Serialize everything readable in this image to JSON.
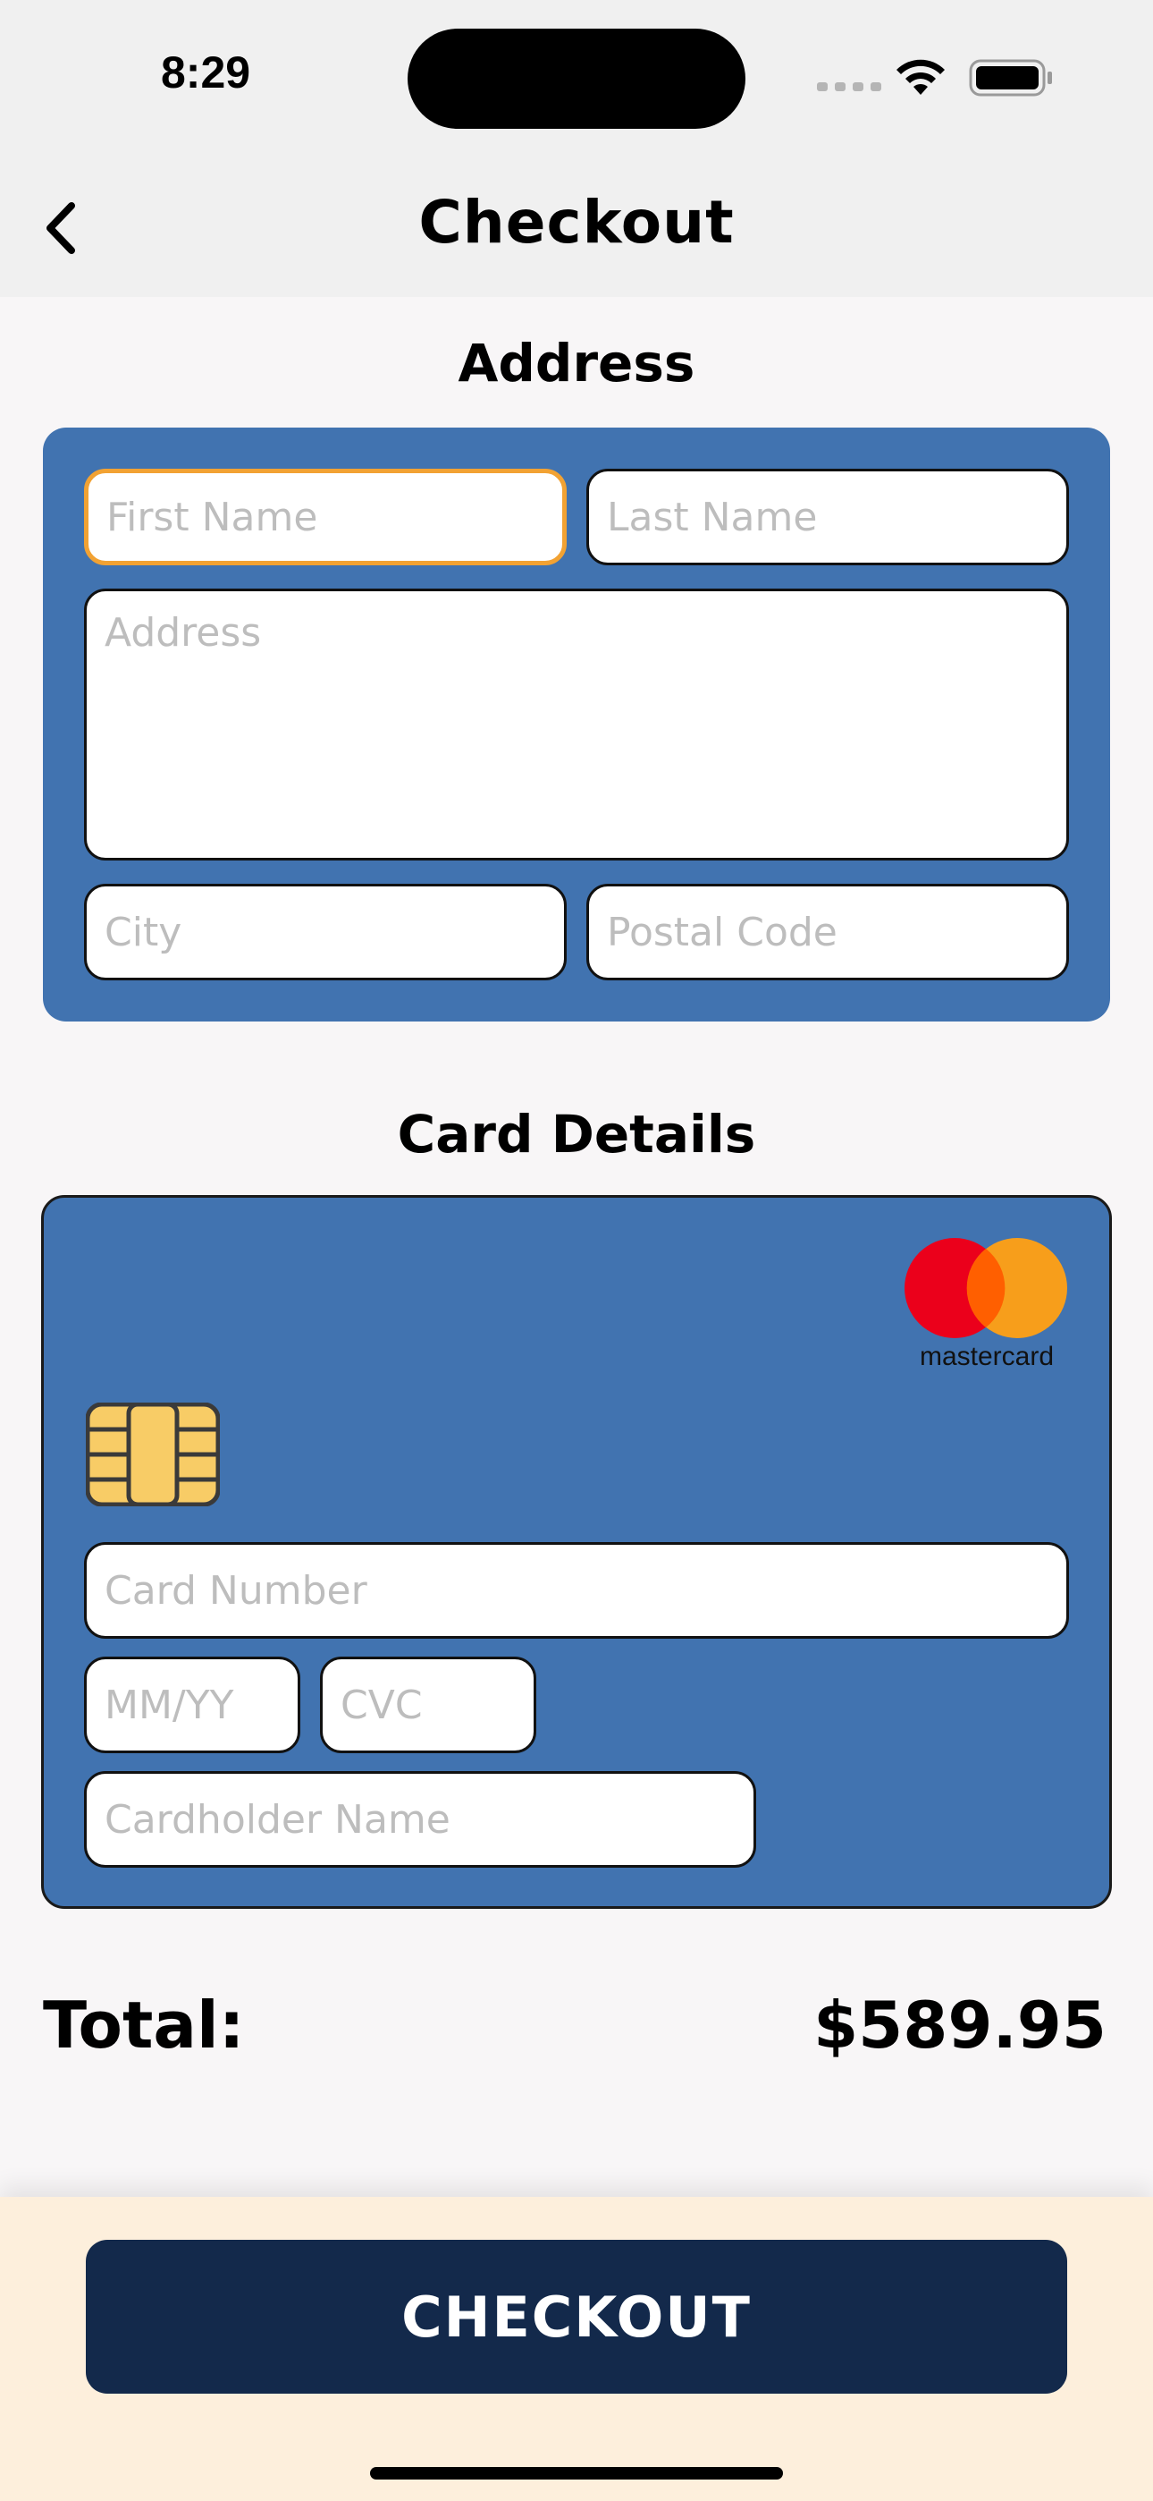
{
  "status_bar": {
    "time": "8:29"
  },
  "nav": {
    "title": "Checkout",
    "back_icon": "chevron-left-icon"
  },
  "address_section": {
    "title": "Address",
    "first_name_placeholder": "First Name",
    "last_name_placeholder": "Last Name",
    "address_placeholder": "Address",
    "city_placeholder": "City",
    "postal_code_placeholder": "Postal Code"
  },
  "card_section": {
    "title": "Card Details",
    "brand": "mastercard",
    "card_number_placeholder": "Card Number",
    "expiry_placeholder": "MM/YY",
    "cvc_placeholder": "CVC",
    "cardholder_placeholder": "Cardholder Name"
  },
  "total": {
    "label": "Total:",
    "value": "$589.95"
  },
  "checkout_button": {
    "label": "CHECKOUT"
  },
  "colors": {
    "panel_blue": "#4173b0",
    "button_navy": "#13294b",
    "focus_orange": "#f2a233",
    "bottom_cream": "#fdefdc"
  }
}
